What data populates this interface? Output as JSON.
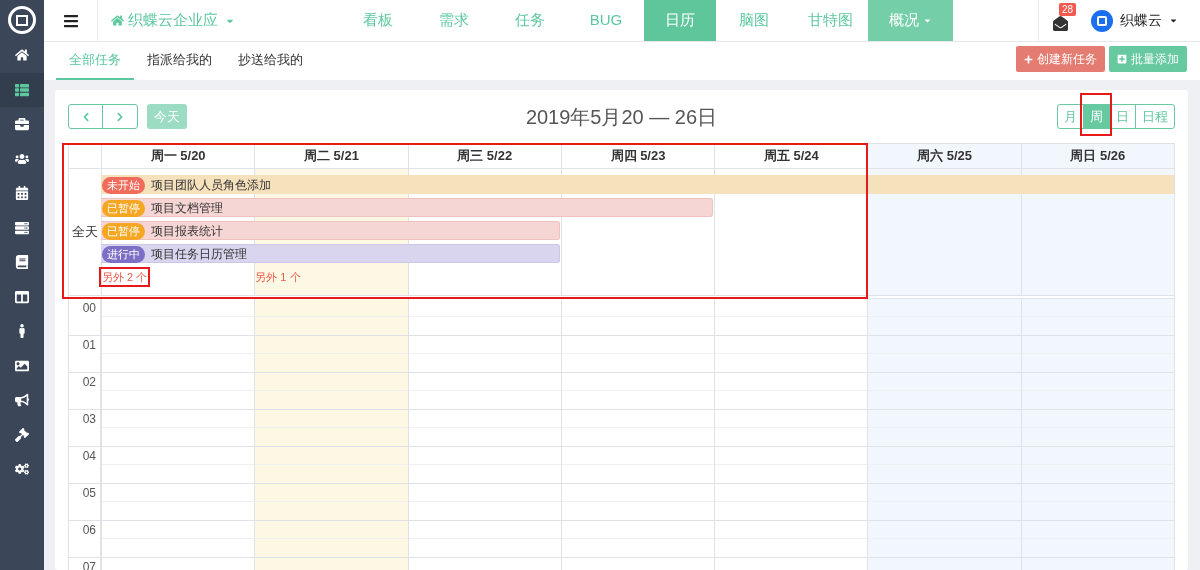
{
  "sidebar": {
    "items": [
      {
        "selected": false
      },
      {
        "selected": true
      },
      {
        "selected": false
      },
      {
        "selected": false
      },
      {
        "selected": false
      },
      {
        "selected": false
      },
      {
        "selected": false
      },
      {
        "selected": false
      },
      {
        "selected": false
      },
      {
        "selected": false
      },
      {
        "selected": false
      },
      {
        "selected": false
      },
      {
        "selected": false
      }
    ]
  },
  "topbar": {
    "project": "织蝶云企业应",
    "nav": [
      {
        "label": "看板",
        "kind": "link",
        "selected": false
      },
      {
        "label": "需求",
        "kind": "link",
        "selected": false
      },
      {
        "label": "任务",
        "kind": "link",
        "selected": false
      },
      {
        "label": "BUG",
        "kind": "link",
        "selected": false
      },
      {
        "label": "日历",
        "kind": "link",
        "selected": true
      },
      {
        "label": "脑图",
        "kind": "link",
        "selected": false
      },
      {
        "label": "甘特图",
        "kind": "link",
        "selected": false
      },
      {
        "label": "概况",
        "kind": "dropdown",
        "selected": false
      }
    ],
    "notification_count": "28",
    "user": "织蝶云"
  },
  "subtabs": [
    {
      "label": "全部任务",
      "selected": true
    },
    {
      "label": "指派给我的",
      "selected": false
    },
    {
      "label": "抄送给我的",
      "selected": false
    }
  ],
  "actions": [
    {
      "label": "创建新任务",
      "kind": "create"
    },
    {
      "label": "批量添加",
      "kind": "batch"
    }
  ],
  "calendar": {
    "title": "2019年5月20 — 26日",
    "today_button": "今天",
    "highlight_weekdays": true,
    "views": [
      {
        "label": "月",
        "selected": false,
        "highlighted": false
      },
      {
        "label": "周",
        "selected": true,
        "highlighted": true
      },
      {
        "label": "日",
        "selected": false,
        "highlighted": false
      },
      {
        "label": "日程",
        "selected": false,
        "highlighted": false
      }
    ],
    "all_day_label": "全天",
    "days": [
      {
        "label": "周一 5/20",
        "today": false,
        "weekend": false,
        "more": "另外 2 个",
        "more_highlighted": true
      },
      {
        "label": "周二 5/21",
        "today": true,
        "weekend": false,
        "more": "另外 1 个",
        "more_highlighted": false
      },
      {
        "label": "周三 5/22",
        "today": false,
        "weekend": false
      },
      {
        "label": "周四 5/23",
        "today": false,
        "weekend": false
      },
      {
        "label": "周五 5/24",
        "today": false,
        "weekend": false
      },
      {
        "label": "周六 5/25",
        "today": false,
        "weekend": true
      },
      {
        "label": "周日 5/26",
        "today": false,
        "weekend": true
      }
    ],
    "events": [
      {
        "status": "未开始",
        "kind": "not_started",
        "title": "项目团队人员角色添加",
        "segments": [
          {
            "continues": true
          },
          {
            "continues": true
          },
          {
            "continues": true
          },
          {
            "continues": true
          },
          {
            "continues": true
          },
          {
            "continues": true
          },
          {
            "continues": true
          }
        ]
      },
      {
        "status": "已暂停",
        "kind": "paused",
        "title": "项目文档管理",
        "segments": [
          {
            "continues": true
          },
          {
            "continues": true
          },
          {
            "continues": true
          },
          {
            "continues": false
          }
        ]
      },
      {
        "status": "已暂停",
        "kind": "paused",
        "title": "项目报表统计",
        "segments": [
          {
            "continues": true
          },
          {
            "continues": true
          },
          {
            "continues": false
          }
        ]
      },
      {
        "status": "进行中",
        "kind": "in_progress",
        "title": "项目任务日历管理",
        "segments": [
          {
            "continues": true
          },
          {
            "continues": true
          },
          {
            "continues": false
          }
        ]
      }
    ],
    "hours": [
      "00",
      "01",
      "02",
      "03",
      "04",
      "05",
      "06",
      "07"
    ]
  }
}
